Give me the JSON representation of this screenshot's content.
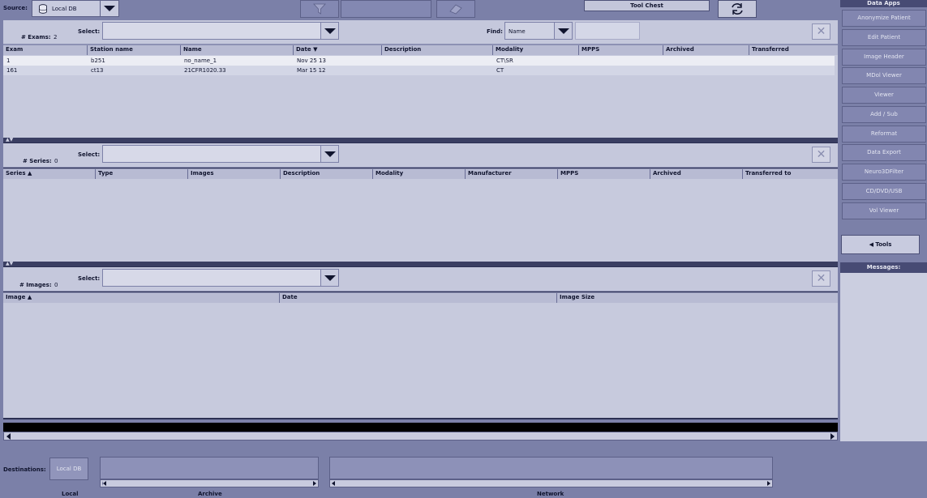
{
  "source": {
    "label": "Source:",
    "value": "Local DB"
  },
  "toolbar": {
    "tool_chest_label": "Tool Chest"
  },
  "exams": {
    "count_label": "# Exams:",
    "count": "2",
    "select_label": "Select:",
    "find_label": "Find:",
    "find_field": "Name",
    "columns": [
      "Exam",
      "Station name",
      "Name",
      "Date ▼",
      "Description",
      "Modality",
      "MPPS",
      "Archived",
      "Transferred"
    ],
    "rows": [
      [
        "1",
        "b251",
        "no_name_1",
        "Nov 25 13",
        "",
        "CT\\SR",
        "",
        "",
        ""
      ],
      [
        "161",
        "ct13",
        "21CFR1020.33",
        "Mar 15 12",
        "",
        "CT",
        "",
        "",
        ""
      ]
    ]
  },
  "series": {
    "count_label": "# Series:",
    "count": "0",
    "select_label": "Select:",
    "columns": [
      "Series ▲",
      "Type",
      "Images",
      "Description",
      "Modality",
      "Manufacturer",
      "MPPS",
      "Archived",
      "Transferred to"
    ]
  },
  "images": {
    "count_label": "# Images:",
    "count": "0",
    "select_label": "Select:",
    "columns": [
      "Image ▲",
      "Date",
      "Image Size"
    ]
  },
  "destinations": {
    "label": "Destinations:",
    "local_button": "Local DB",
    "local_label": "Local",
    "archive_label": "Archive",
    "network_label": "Network"
  },
  "sidebar": {
    "title": "Data Apps",
    "apps": [
      "Anonymize Patient",
      "Edit Patient",
      "Image Header",
      "MDol Viewer",
      "Viewer",
      "Add / Sub",
      "Reformat",
      "Data Export",
      "Neuro3DFilter",
      "CD/DVD/USB",
      "Vol Viewer"
    ],
    "tools_label": "◀  Tools",
    "messages_title": "Messages:"
  }
}
